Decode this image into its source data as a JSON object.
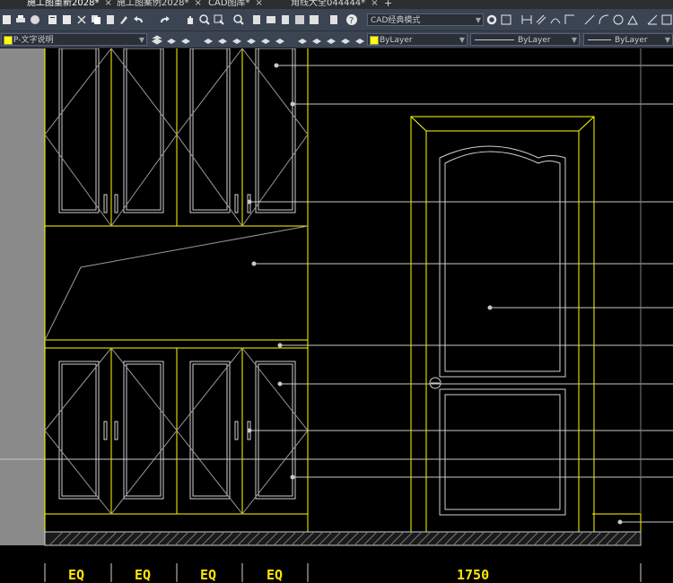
{
  "tabs": [
    {
      "label": "施工图重新2028*",
      "active": true
    },
    {
      "label": "施工图案例2028*",
      "active": false
    },
    {
      "label": "CAD图库*",
      "active": false
    },
    {
      "label": "角线大全044444*",
      "active": false
    }
  ],
  "tab_add": "+",
  "tab_close": "×",
  "workspace": {
    "value": "CAD经典模式"
  },
  "layer": {
    "value": "P-文字说明",
    "color": "#ffff00"
  },
  "properties": {
    "color": "ByLayer",
    "linetype": "ByLayer",
    "lineweight": "ByLayer"
  },
  "dimensions": {
    "labels": [
      "EQ",
      "EQ",
      "EQ",
      "EQ",
      "1750"
    ]
  },
  "colors": {
    "drawing_line": "#ffff00",
    "detail_line": "#cfcfcf",
    "leader": "#c8c8c8",
    "dimension_text": "#ffe600",
    "background": "#000000"
  }
}
